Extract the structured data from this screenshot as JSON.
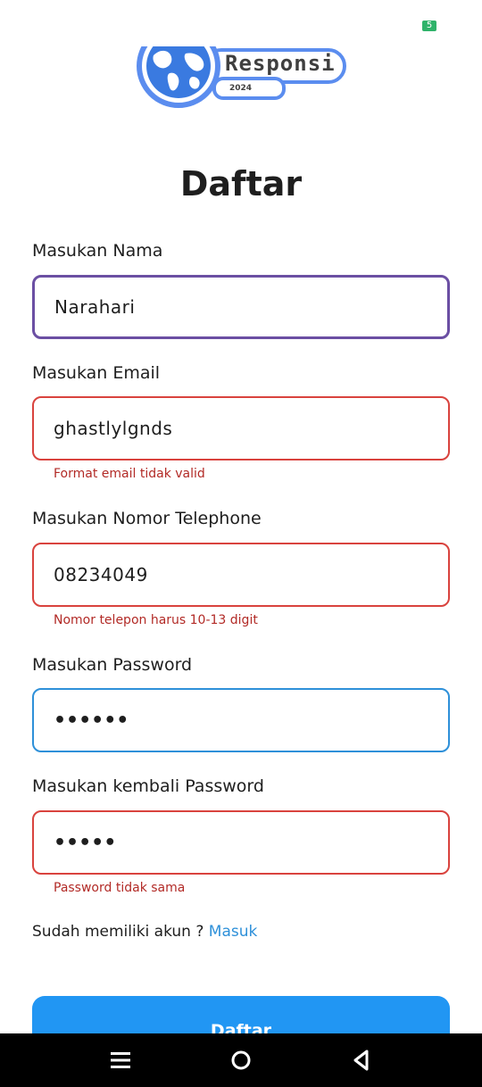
{
  "status_bar": {
    "battery": "5"
  },
  "logo": {
    "text": "Responsi",
    "year": "2024"
  },
  "page_title": "Daftar",
  "form": {
    "name": {
      "label": "Masukan Nama",
      "value": "Narahari"
    },
    "email": {
      "label": "Masukan Email",
      "value": "ghastlylgnds",
      "error": "Format email tidak valid"
    },
    "phone": {
      "label": "Masukan Nomor Telephone",
      "value": "08234049",
      "error": "Nomor telepon harus 10-13 digit"
    },
    "password": {
      "label": "Masukan Password",
      "value": "••••••"
    },
    "confirm_password": {
      "label": "Masukan kembali Password",
      "value": "•••••",
      "error": "Password tidak sama"
    }
  },
  "login_prompt": {
    "text": "Sudah memiliki akun ? ",
    "link": "Masuk"
  },
  "submit_label": "Daftar",
  "colors": {
    "primary": "#2196f3",
    "error": "#d9433e",
    "focus": "#6b4fa3",
    "link": "#2e90d9"
  },
  "nav_icons": [
    "menu-icon",
    "home-icon",
    "back-icon"
  ]
}
